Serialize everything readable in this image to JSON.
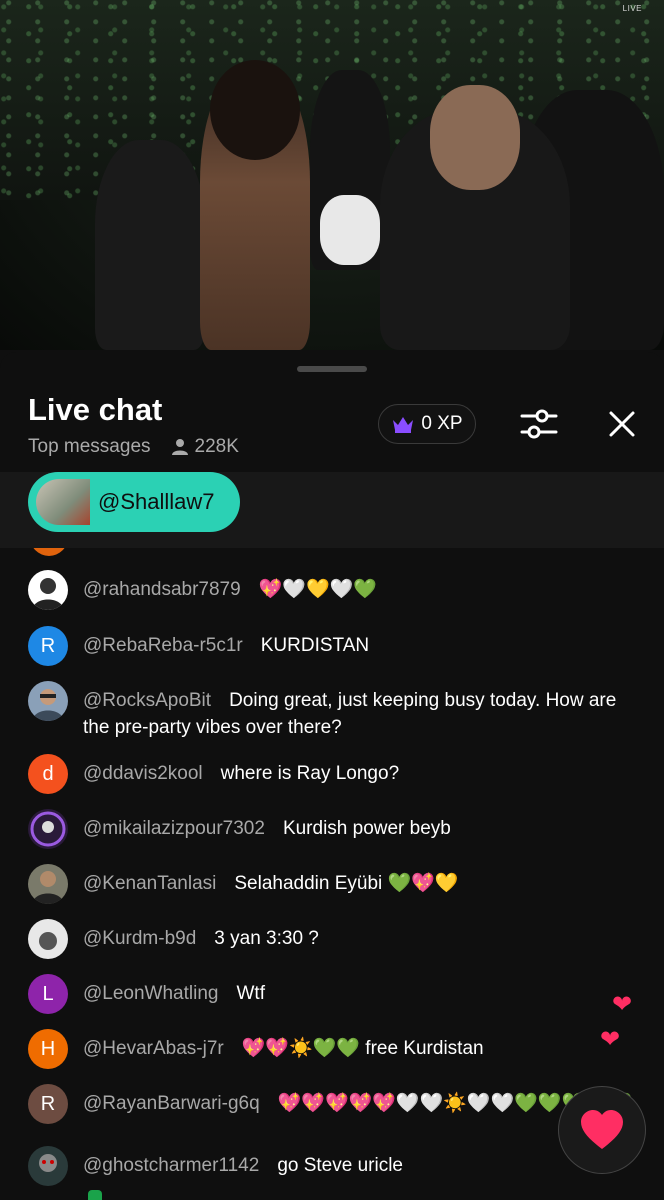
{
  "video": {
    "live_badge": "LIVE"
  },
  "chat": {
    "title": "Live chat",
    "mode": "Top messages",
    "viewers": "228K",
    "xp_label": "0 XP",
    "pinned_user": "@Shalllaw7"
  },
  "messages": [
    {
      "author": "@rahandsabr7879",
      "text": "",
      "emoji": "💖🤍💛🤍💚",
      "avatar_type": "photo",
      "avatar_color": "#ffffff"
    },
    {
      "author": "@RebaReba-r5c1r",
      "text": "KURDISTAN",
      "emoji": "",
      "avatar_letter": "R",
      "avatar_color": "#1e88e5"
    },
    {
      "author": "@RocksApoBit",
      "text": "Doing great, just keeping busy today. How are the pre-party vibes over there?",
      "emoji": "",
      "avatar_type": "photo",
      "avatar_color": "#8aa0b8"
    },
    {
      "author": "@ddavis2kool",
      "text": "where is Ray Longo?",
      "emoji": "",
      "avatar_letter": "d",
      "avatar_color": "#f4511e"
    },
    {
      "author": "@mikailazizpour7302",
      "text": "Kurdish power beyb",
      "emoji": "",
      "avatar_type": "photo",
      "avatar_color": "#6a3aa0"
    },
    {
      "author": "@KenanTanlasi",
      "text": "Selahaddin Eyübi",
      "emoji": "💚💖💛",
      "avatar_type": "photo",
      "avatar_color": "#7a7a6a"
    },
    {
      "author": "@Kurdm-b9d",
      "text": "3 yan 3:30 ?",
      "emoji": "",
      "avatar_type": "photo",
      "avatar_color": "#e8e8e8"
    },
    {
      "author": "@LeonWhatling",
      "text": "Wtf",
      "emoji": "",
      "avatar_letter": "L",
      "avatar_color": "#8e24aa"
    },
    {
      "author": "@HevarAbas-j7r",
      "text": "free Kurdistan",
      "emoji": "💖💖☀️💚💚",
      "avatar_letter": "H",
      "avatar_color": "#ef6c00"
    },
    {
      "author": "@RayanBarwari-g6q",
      "text": "",
      "emoji": "💖💖💖💖💖🤍🤍☀️🤍🤍💚💚💚💚💚",
      "avatar_letter": "R",
      "avatar_color": "#6d4c41"
    },
    {
      "author": "@ghostcharmer1142",
      "text": "go Steve uricle",
      "emoji": "",
      "avatar_type": "photo",
      "avatar_color": "#2a3a3a"
    }
  ],
  "reaction": {
    "icon": "heart-icon",
    "color": "#ff2e63"
  },
  "floating_hearts": [
    "❤",
    "❤"
  ]
}
